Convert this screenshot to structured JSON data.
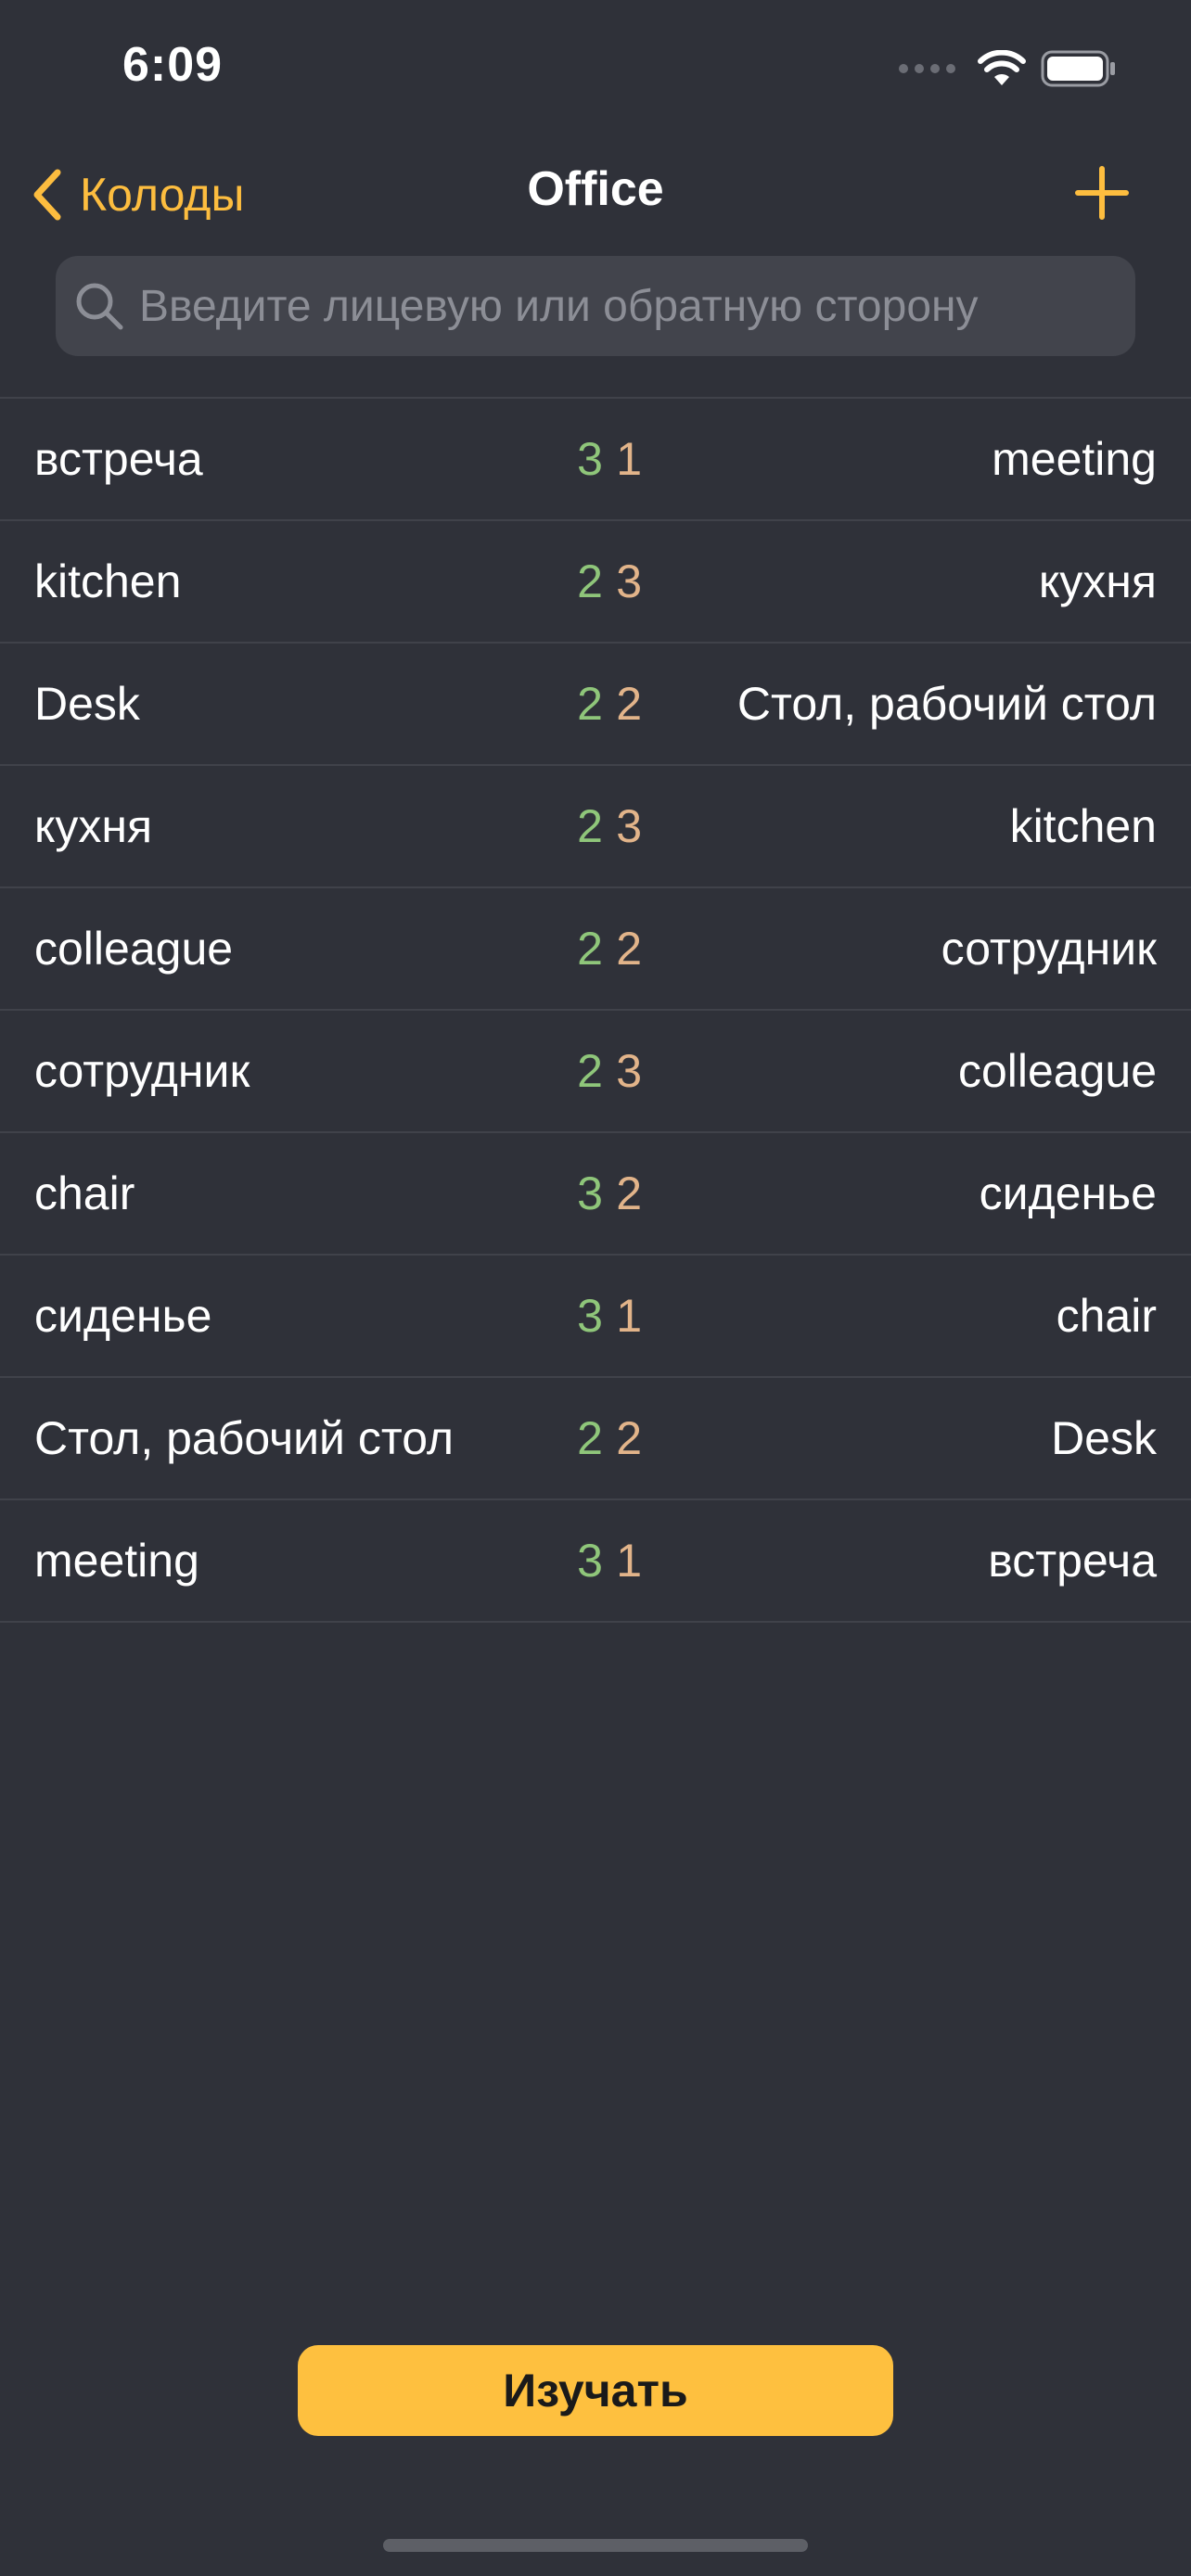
{
  "status_bar": {
    "time": "6:09",
    "icons": [
      "signal-icon",
      "wifi-icon",
      "battery-icon"
    ]
  },
  "nav": {
    "back_label": "Колоды",
    "title": "Office",
    "add_icon": "plus-icon"
  },
  "search": {
    "placeholder": "Введите лицевую или обратную сторону",
    "value": ""
  },
  "cards": [
    {
      "front": "встреча",
      "known": "3",
      "learning": "1",
      "back": "meeting"
    },
    {
      "front": "kitchen",
      "known": "2",
      "learning": "3",
      "back": "кухня"
    },
    {
      "front": "Desk",
      "known": "2",
      "learning": "2",
      "back": "Стол, рабочий стол"
    },
    {
      "front": "кухня",
      "known": "2",
      "learning": "3",
      "back": "kitchen"
    },
    {
      "front": "colleague",
      "known": "2",
      "learning": "2",
      "back": "сотрудник"
    },
    {
      "front": "сотрудник",
      "known": "2",
      "learning": "3",
      "back": "colleague"
    },
    {
      "front": "chair",
      "known": "3",
      "learning": "2",
      "back": "сиденье"
    },
    {
      "front": "сиденье",
      "known": "3",
      "learning": "1",
      "back": "chair"
    },
    {
      "front": "Стол, рабочий стол",
      "known": "2",
      "learning": "2",
      "back": "Desk"
    },
    {
      "front": "meeting",
      "known": "3",
      "learning": "1",
      "back": "встреча"
    }
  ],
  "study_button": {
    "label": "Изучать"
  },
  "colors": {
    "background": "#2f3139",
    "accent": "#fdbd3f",
    "known_count": "#8fc67a",
    "learning_count": "#e2b48a",
    "search_bg": "#42444c"
  }
}
